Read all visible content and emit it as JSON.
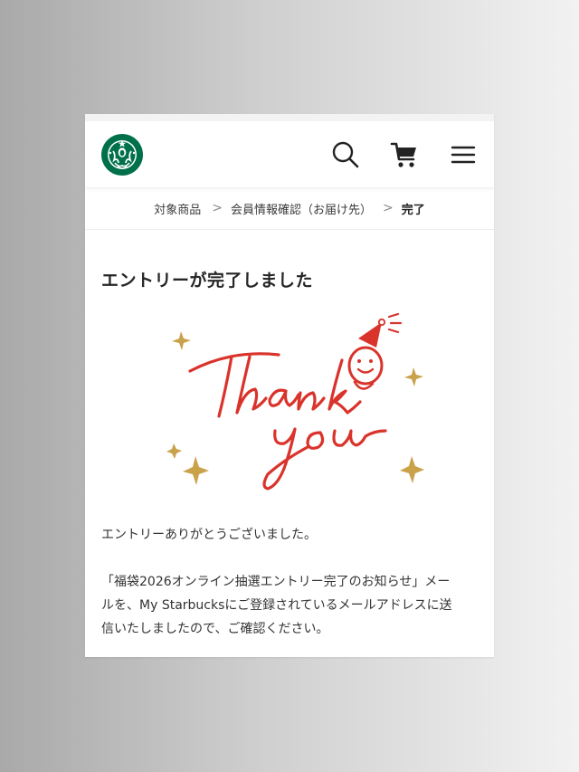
{
  "brand": {
    "logo_icon": "starbucks-siren-logo",
    "green": "#00704a"
  },
  "header": {
    "icons": [
      "search-icon",
      "cart-icon",
      "menu-icon"
    ]
  },
  "breadcrumb": {
    "step1": "対象商品",
    "step2": "会員情報確認（お届け先）",
    "step3": "完了",
    "separator": ">"
  },
  "main": {
    "title": "エントリーが完了しました",
    "illustration": {
      "text_line1": "Thank",
      "text_line2": "you",
      "accent_red": "#d9332b",
      "sparkle_gold": "#c9a24a"
    },
    "paragraph1": "エントリーありがとうございました。",
    "paragraph2_lines": [
      "「福袋2026オンライン抽選エントリー完了のお知らせ」メー",
      "ルを、My Starbucksにご登録されているメールアドレスに送",
      "信いたしましたので、ご確認ください。"
    ]
  }
}
